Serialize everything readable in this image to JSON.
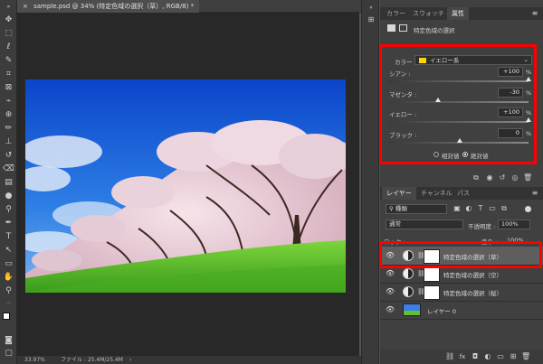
{
  "document": {
    "tab_title": "sample.psd @ 34% (特定色域の選択（草）, RGB/8) *",
    "close_glyph": "×"
  },
  "status": {
    "zoom": "33.97%",
    "file_info": "ファイル : 25.4M/25.4M",
    "arrow": "›"
  },
  "properties_panel": {
    "tabs": [
      "カラー",
      "スウォッチ",
      "属性"
    ],
    "active_tab": "属性",
    "title": "特定色域の選択",
    "color_label": "カラー :",
    "color_value": "イエロー系",
    "color_swatch": "#ffd400",
    "sliders": [
      {
        "label": "シアン :",
        "value": "+100",
        "unit": "%",
        "position": 1.0
      },
      {
        "label": "マゼンタ :",
        "value": "-30",
        "unit": "%",
        "position": 0.35
      },
      {
        "label": "イエロー :",
        "value": "+100",
        "unit": "%",
        "position": 1.0
      },
      {
        "label": "ブラック :",
        "value": "0",
        "unit": "%",
        "position": 0.5
      }
    ],
    "method_relative": "相対値",
    "method_absolute": "絶対値",
    "selected_method": "絶対値"
  },
  "layers_panel": {
    "tabs": [
      "レイヤー",
      "チャンネル",
      "パス"
    ],
    "active_tab": "レイヤー",
    "filter_kind": "種類",
    "blend_mode": "通常",
    "opacity_label": "不透明度 :",
    "opacity_value": "100%",
    "lock_label": "ロック :",
    "fill_label": "塗り :",
    "fill_value": "100%",
    "layers": [
      {
        "name": "特定色域の選択（草）",
        "type": "adjustment",
        "selected": true,
        "visible": true
      },
      {
        "name": "特定色域の選択（空）",
        "type": "adjustment",
        "selected": false,
        "visible": true
      },
      {
        "name": "特定色域の選択（桜）",
        "type": "adjustment",
        "selected": false,
        "visible": true
      },
      {
        "name": "レイヤー 0",
        "type": "image",
        "selected": false,
        "visible": true
      }
    ]
  },
  "colors": {
    "highlight_red": "#ff0000",
    "panel_bg": "#404040",
    "canvas_bg": "#282828",
    "sky_blue": "#1a5fd6",
    "grass_green": "#5cc42e"
  },
  "icons": {
    "eye": "visibility-eye-icon",
    "link": "chain-link-icon"
  }
}
